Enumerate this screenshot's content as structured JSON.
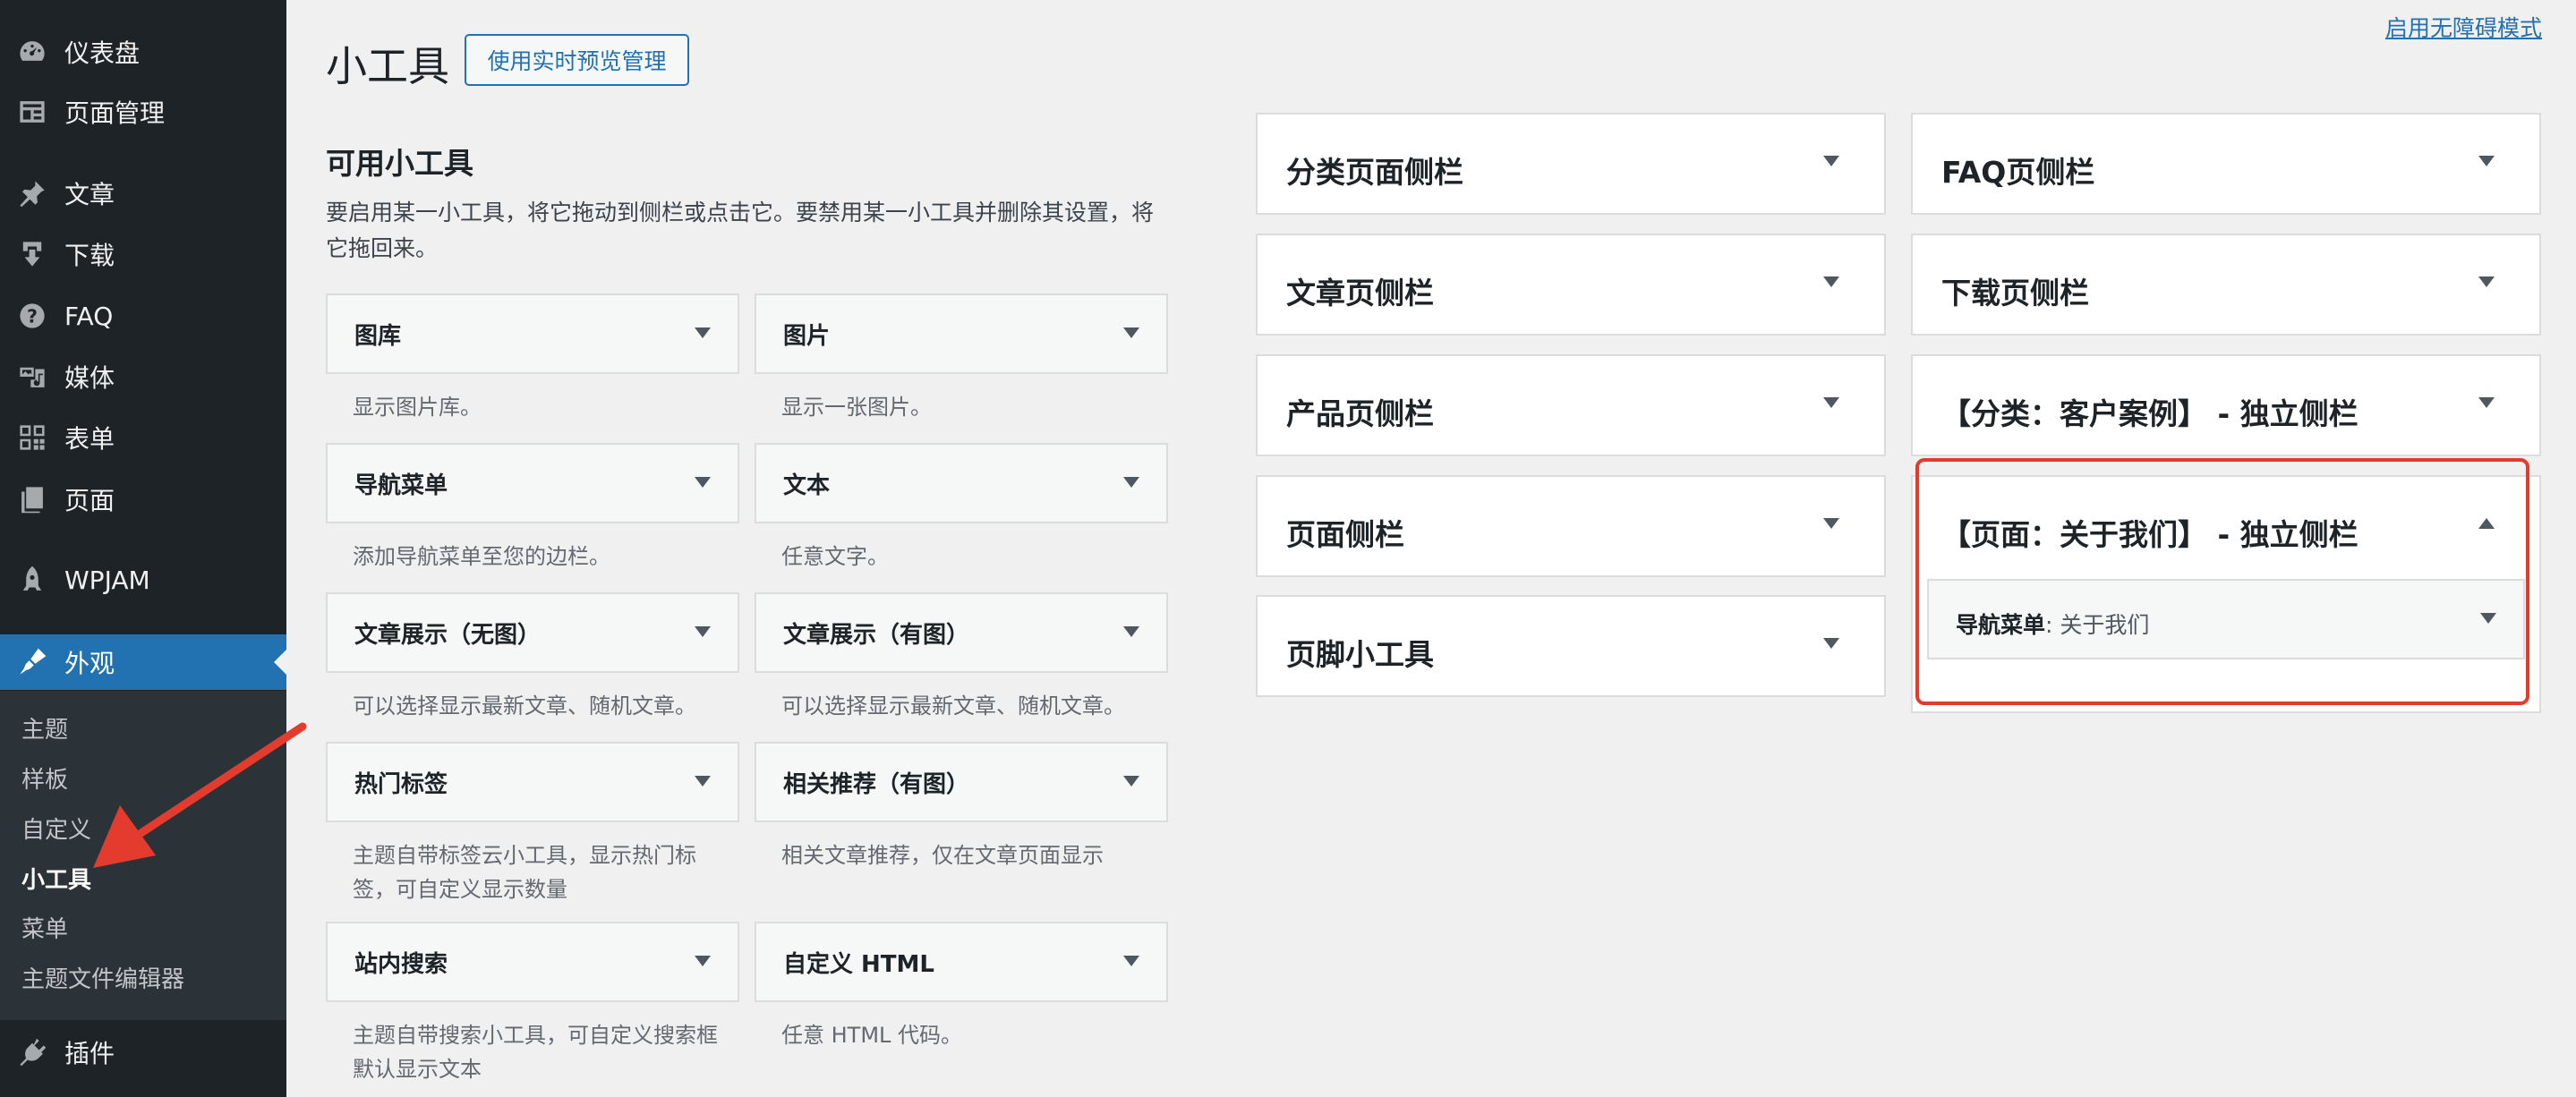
{
  "sidebar_menu": {
    "items": [
      {
        "label": "仪表盘",
        "icon": "dashboard-icon"
      },
      {
        "label": "页面管理",
        "icon": "page-manage-icon"
      },
      {
        "label": "文章",
        "icon": "pin-icon"
      },
      {
        "label": "下载",
        "icon": "download-icon"
      },
      {
        "label": "FAQ",
        "icon": "help-icon"
      },
      {
        "label": "媒体",
        "icon": "media-icon"
      },
      {
        "label": "表单",
        "icon": "form-icon"
      },
      {
        "label": "页面",
        "icon": "pages-icon"
      },
      {
        "label": "WPJAM",
        "icon": "rocket-icon"
      },
      {
        "label": "外观",
        "icon": "brush-icon",
        "current": true
      },
      {
        "label": "插件",
        "icon": "plugin-icon"
      }
    ],
    "submenu": [
      "主题",
      "样板",
      "自定义",
      "小工具",
      "菜单",
      "主题文件编辑器"
    ],
    "active_submenu": "小工具"
  },
  "header": {
    "title": "小工具",
    "preview_button": "使用实时预览管理",
    "accessibility_link": "启用无障碍模式"
  },
  "available": {
    "heading": "可用小工具",
    "description": "要启用某一小工具，将它拖动到侧栏或点击它。要禁用某一小工具并删除其设置，将它拖回来。",
    "widgets": [
      {
        "title": "图库",
        "desc": "显示图片库。"
      },
      {
        "title": "图片",
        "desc": "显示一张图片。"
      },
      {
        "title": "导航菜单",
        "desc": "添加导航菜单至您的边栏。"
      },
      {
        "title": "文本",
        "desc": "任意文字。"
      },
      {
        "title": "文章展示（无图）",
        "desc": "可以选择显示最新文章、随机文章。"
      },
      {
        "title": "文章展示（有图）",
        "desc": "可以选择显示最新文章、随机文章。"
      },
      {
        "title": "热门标签",
        "desc": "主题自带标签云小工具，显示热门标签，可自定义显示数量"
      },
      {
        "title": "相关推荐（有图）",
        "desc": "相关文章推荐，仅在文章页面显示"
      },
      {
        "title": "站内搜索",
        "desc": "主题自带搜索小工具，可自定义搜索框默认显示文本"
      },
      {
        "title": "自定义 HTML",
        "desc": "任意 HTML 代码。"
      }
    ]
  },
  "sidebars": {
    "left_column": [
      "分类页面侧栏",
      "文章页侧栏",
      "产品页侧栏",
      "页面侧栏",
      "页脚小工具"
    ],
    "right_column": [
      "FAQ页侧栏",
      "下载页侧栏",
      "【分类：客户案例】 - 独立侧栏",
      "【页面：关于我们】 - 独立侧栏"
    ],
    "expanded_widget": {
      "type": "导航菜单",
      "title": ": 关于我们"
    }
  },
  "colors": {
    "sidebar_bg": "#1d2327",
    "accent": "#2271b1",
    "highlight": "#e33b2e"
  }
}
